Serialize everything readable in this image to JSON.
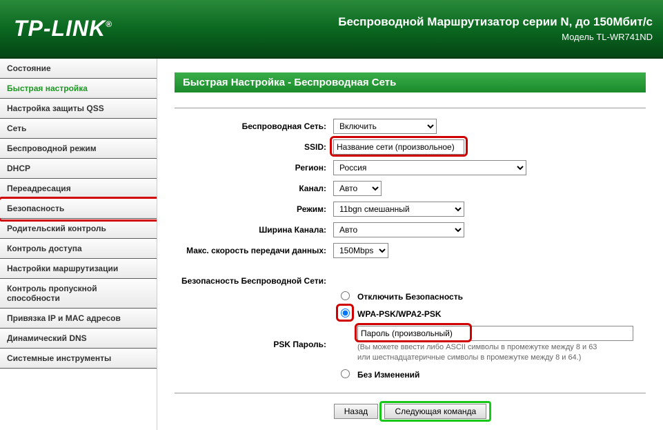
{
  "header": {
    "logo": "TP-LINK",
    "title": "Беспроводной Маршрутизатор серии N, до 150Мбит/с",
    "model": "Модель TL-WR741ND"
  },
  "sidebar": {
    "items": [
      {
        "label": "Состояние",
        "active": false
      },
      {
        "label": "Быстрая настройка",
        "active": true
      },
      {
        "label": "Настройка защиты QSS",
        "active": false
      },
      {
        "label": "Сеть",
        "active": false
      },
      {
        "label": "Беспроводной режим",
        "active": false
      },
      {
        "label": "DHCP",
        "active": false
      },
      {
        "label": "Переадресация",
        "active": false
      },
      {
        "label": "Безопасность",
        "active": false,
        "highlighted": true
      },
      {
        "label": "Родительский контроль",
        "active": false
      },
      {
        "label": "Контроль доступа",
        "active": false
      },
      {
        "label": "Настройки маршрутизации",
        "active": false
      },
      {
        "label": "Контроль пропускной способности",
        "active": false
      },
      {
        "label": "Привязка IP и MAC адресов",
        "active": false
      },
      {
        "label": "Динамический DNS",
        "active": false
      },
      {
        "label": "Системные инструменты",
        "active": false
      }
    ]
  },
  "page": {
    "title": "Быстрая Настройка - Беспроводная Сеть",
    "labels": {
      "wireless": "Беспроводная Сеть:",
      "ssid": "SSID:",
      "region": "Регион:",
      "channel": "Канал:",
      "mode": "Режим:",
      "channel_width": "Ширина Канала:",
      "max_rate": "Макс. скорость передачи данных:",
      "security": "Безопасность Беспроводной Сети:",
      "psk_password": "PSK Пароль:"
    },
    "values": {
      "wireless": "Включить",
      "ssid": "Название сети (произвольное)",
      "region": "Россия",
      "channel": "Авто",
      "mode": "11bgn смешанный",
      "channel_width": "Авто",
      "max_rate": "150Mbps",
      "psk_password": "Пароль (произвольный)"
    },
    "security_options": {
      "disable": "Отключить Безопасность",
      "wpa": "WPA-PSK/WPA2-PSK",
      "nochange": "Без Изменений"
    },
    "hint_line1": "(Вы можете ввести либо ASCII символы в промежутке между 8 и 63",
    "hint_line2": "или шестнадцатеричные символы в промежутке между 8 и 64.)",
    "buttons": {
      "back": "Назад",
      "next": "Следующая команда"
    }
  }
}
